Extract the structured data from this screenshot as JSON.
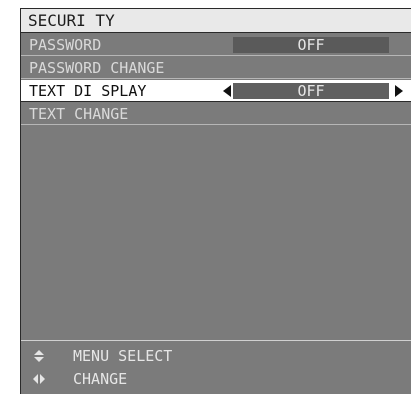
{
  "menu": {
    "title": "SECURI TY",
    "items": [
      {
        "label": "PASSWORD",
        "value": "OFF"
      },
      {
        "label": "PASSWORD  CHANGE"
      },
      {
        "label": "TEXT  DI SPLAY",
        "value": "OFF"
      },
      {
        "label": "TEXT  CHANGE"
      }
    ]
  },
  "help": {
    "items": [
      {
        "icon": "up-down-arrows-icon",
        "label": "MENU  SELECT"
      },
      {
        "icon": "left-right-arrows-icon",
        "label": "CHANGE"
      }
    ]
  },
  "colors": {
    "panel": "#7b7b7b",
    "title_bar": "#e9e9e9",
    "selected_row": "#ffffff",
    "value_box": "#5a5a5a"
  }
}
